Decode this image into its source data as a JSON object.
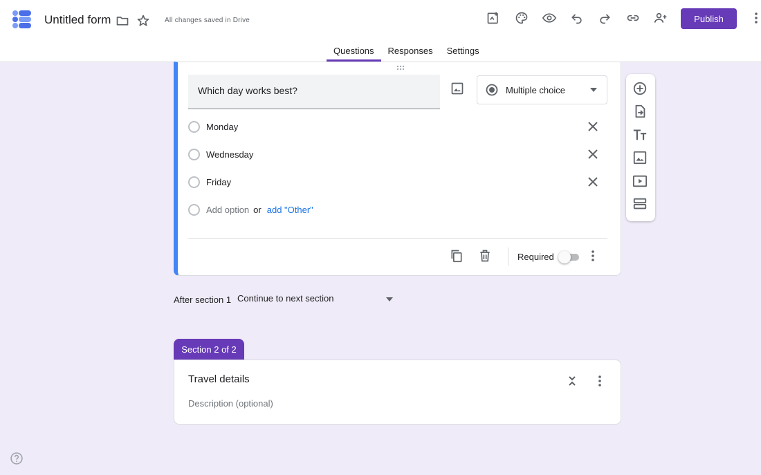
{
  "header": {
    "title": "Untitled form",
    "saved_status": "All changes saved in Drive",
    "publish_label": "Publish",
    "brand_color": "#673ab7",
    "icons": [
      "folder-icon",
      "star-icon",
      "customize-icon",
      "palette-icon",
      "preview-icon",
      "undo-icon",
      "redo-icon",
      "link-icon",
      "add-collaborator-icon",
      "more-vert-icon"
    ]
  },
  "tabs": [
    {
      "label": "Questions",
      "active": true
    },
    {
      "label": "Responses",
      "active": false
    },
    {
      "label": "Settings",
      "active": false
    }
  ],
  "question": {
    "title": "Which day works best?",
    "type": "Multiple choice",
    "options": [
      "Monday",
      "Wednesday",
      "Friday"
    ],
    "add_option": "Add option",
    "or": "or",
    "add_other": "add \"Other\"",
    "required_label": "Required",
    "required": false,
    "accent_color": "#4285f4"
  },
  "toolbar": [
    "add-question-icon",
    "import-questions-icon",
    "add-title-icon",
    "add-image-icon",
    "add-video-icon",
    "add-section-icon"
  ],
  "after_section": {
    "label": "After section 1",
    "value": "Continue to next section"
  },
  "section2": {
    "tab_label": "Section 2 of 2",
    "title": "Travel details",
    "description_placeholder": "Description (optional)"
  }
}
